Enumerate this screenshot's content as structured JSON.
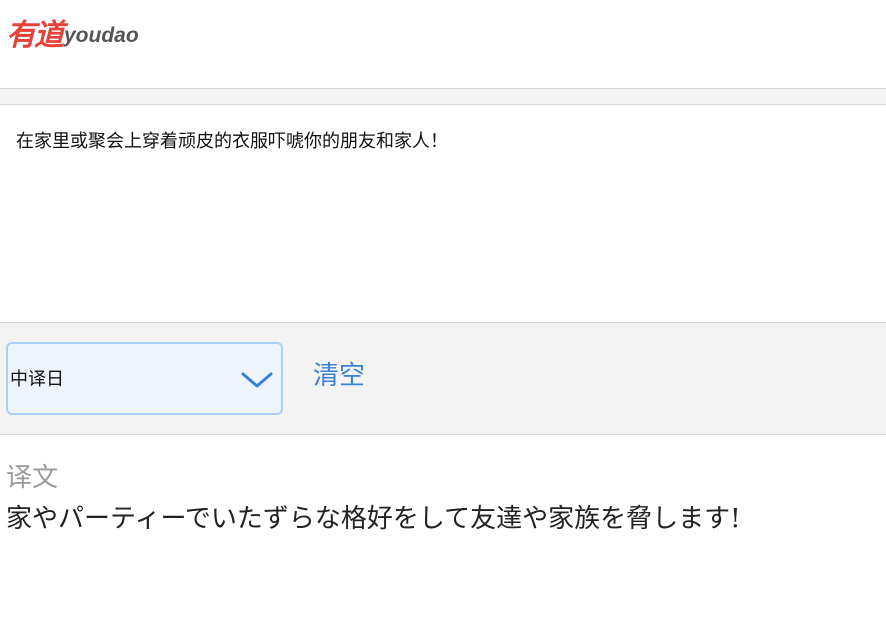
{
  "header": {
    "logo_cn": "有道",
    "logo_en": "youdao",
    "brand_color": "#e8413a"
  },
  "source": {
    "text": "在家里或聚会上穿着顽皮的衣服吓唬你的朋友和家人！"
  },
  "controls": {
    "language_option": "中译日",
    "dropdown_icon": "chevron-down-icon",
    "clear_label": "清空",
    "accent_color": "#3b82d6"
  },
  "result": {
    "label": "译文",
    "text": "家やパーティーでいたずらな格好をして友達や家族を脅します!"
  }
}
